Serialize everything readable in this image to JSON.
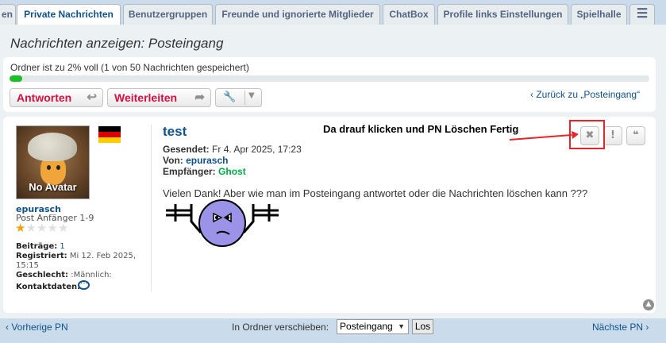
{
  "tabs": [
    {
      "label": "en",
      "active": false
    },
    {
      "label": "Private Nachrichten",
      "active": true
    },
    {
      "label": "Benutzergruppen",
      "active": false
    },
    {
      "label": "Freunde und ignorierte Mitglieder",
      "active": false
    },
    {
      "label": "ChatBox",
      "active": false
    },
    {
      "label": "Profile links Einstellungen",
      "active": false
    },
    {
      "label": "Spielhalle",
      "active": false
    },
    {
      "label": "☰",
      "active": false
    }
  ],
  "page_title": "Nachrichten anzeigen: Posteingang",
  "folder": {
    "status_text": "Ordner ist zu 2% voll (1 von 50 Nachrichten gespeichert)",
    "fill_percent": 2
  },
  "toolbar": {
    "reply_label": "Antworten",
    "reply_icon": "↩",
    "forward_label": "Weiterleiten",
    "forward_icon": "➦",
    "tools_icon": "wrench-icon",
    "back_link": "‹  Zurück zu „Posteingang“"
  },
  "author": {
    "avatar_text": "No Avatar",
    "username": "epurasch",
    "rank": "Post Anfänger 1-9",
    "stars_filled": 1,
    "stars_total": 5,
    "flag": "germany",
    "posts_label": "Beiträge:",
    "posts_value": "1",
    "registered_label": "Registriert:",
    "registered_value": "Mi 12. Feb 2025,",
    "registered_value_2": "15:15",
    "gender_label": "Geschlecht:",
    "gender_value": ":Männlich:",
    "contact_label": "Kontaktdaten:"
  },
  "message": {
    "title": "test",
    "sent_label": "Gesendet:",
    "sent_value": "Fr 4. Apr 2025, 17:23",
    "from_label": "Von:",
    "from_value": "epurasch",
    "to_label": "Empfänger:",
    "to_value": "Ghost",
    "body": "Vielen Dank! Aber wie man im Posteingang antwortet oder die Nachrichten löschen kann ???"
  },
  "annotation_text": "Da drauf klicken und PN Löschen Fertig",
  "actions": {
    "delete_icon": "✖",
    "report_icon": "!",
    "quote_icon": "❝"
  },
  "footer": {
    "prev_label": "‹  Vorherige PN",
    "next_label": "Nächste PN  ›",
    "move_label": "In Ordner verschieben:",
    "move_selected": "Posteingang",
    "go_label": "Los"
  },
  "colors": {
    "link": "#105289",
    "accent_red": "#d31141",
    "progress_green": "#19c026",
    "annotation_red": "#e8242a",
    "recipient_green": "#00aa44"
  }
}
